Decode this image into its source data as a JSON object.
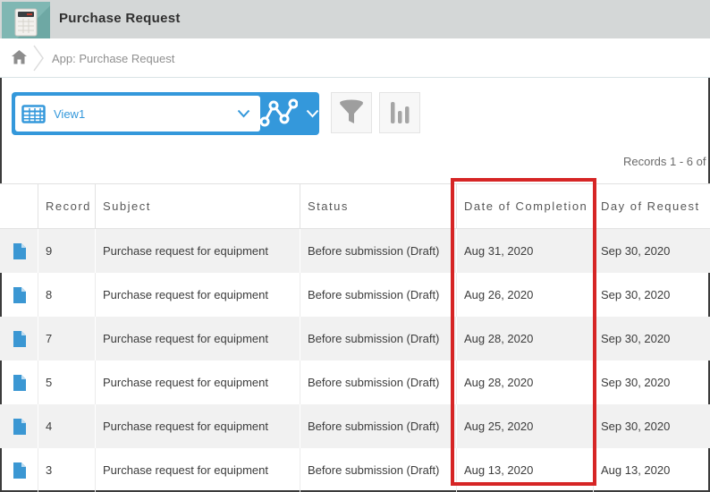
{
  "app": {
    "title": "Purchase Request",
    "icon": "calculator-app-icon"
  },
  "breadcrumb": {
    "path": "App: Purchase Request"
  },
  "toolbar": {
    "view_selector": {
      "selected": "View1"
    },
    "graph_button": {
      "icon": "line-graph-icon"
    },
    "filter_button": {
      "icon": "filter-funnel-icon"
    },
    "chart_button": {
      "icon": "bar-chart-icon"
    }
  },
  "records_summary": "Records 1 - 6 of",
  "table": {
    "columns": [
      "",
      "Record",
      "Subject",
      "Status",
      "Date of Completion",
      "Day of Request"
    ],
    "rows": [
      {
        "record": "9",
        "subject": "Purchase request for equipment",
        "status": "Before submission (Draft)",
        "date_of_completion": "Aug 31, 2020",
        "day_of_request": "Sep 30, 2020"
      },
      {
        "record": "8",
        "subject": "Purchase request for equipment",
        "status": "Before submission (Draft)",
        "date_of_completion": "Aug 26, 2020",
        "day_of_request": "Sep 30, 2020"
      },
      {
        "record": "7",
        "subject": "Purchase request for equipment",
        "status": "Before submission (Draft)",
        "date_of_completion": "Aug 28, 2020",
        "day_of_request": "Sep 30, 2020"
      },
      {
        "record": "5",
        "subject": "Purchase request for equipment",
        "status": "Before submission (Draft)",
        "date_of_completion": "Aug 28, 2020",
        "day_of_request": "Sep 30, 2020"
      },
      {
        "record": "4",
        "subject": "Purchase request for equipment",
        "status": "Before submission (Draft)",
        "date_of_completion": "Aug 25, 2020",
        "day_of_request": "Sep 30, 2020"
      },
      {
        "record": "3",
        "subject": "Purchase request for equipment",
        "status": "Before submission (Draft)",
        "date_of_completion": "Aug 13, 2020",
        "day_of_request": "Aug 13, 2020"
      }
    ]
  },
  "annotation": {
    "highlighted_column": "Date of Completion",
    "color": "#d62525"
  },
  "colors": {
    "accent_blue": "#3498db",
    "header_bar_gray": "#d4d7d7",
    "app_icon_teal": "#7fb7b3",
    "row_stripe": "#f1f1f1"
  }
}
